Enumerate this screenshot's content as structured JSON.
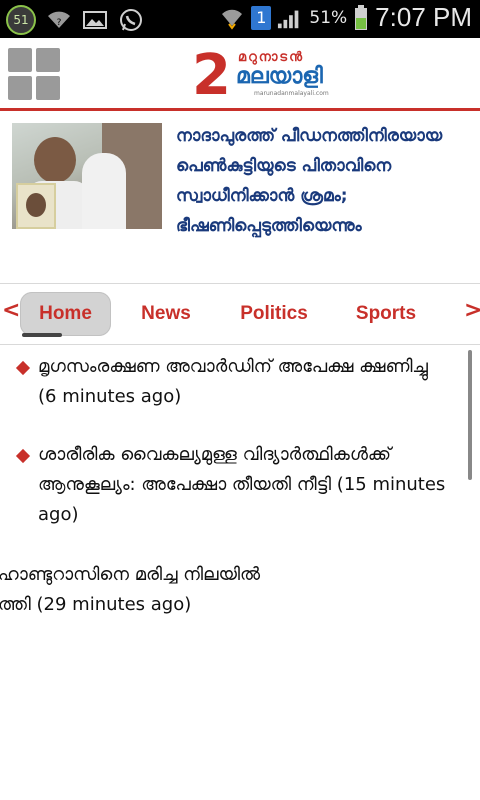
{
  "status_bar": {
    "notification_count": "51",
    "sim_badge": "1",
    "battery": "51%",
    "time": "7:07 PM",
    "icons": [
      "notification-count-icon",
      "wifi-icon",
      "image-icon",
      "whatsapp-icon",
      "wifi-data-icon",
      "signal-icon",
      "battery-icon"
    ]
  },
  "header": {
    "logo_text_top": "മറുനാടൻ",
    "logo_text_main": "മലയാളി",
    "logo_url": "marunadanmalayali.com"
  },
  "featured": {
    "headline": "നാദാപുരത്ത് പീഡനത്തിനിരയായ പെൺകുട്ടിയുടെ പിതാവിനെ സ്വാധീനിക്കാൻ ശ്രമം; ഭീഷണിപ്പെടുത്തിയെന്നും"
  },
  "tabs": {
    "prev_arrow": "<",
    "next_arrow": ">",
    "items": [
      "Home",
      "News",
      "Politics",
      "Sports"
    ],
    "active": "Home"
  },
  "news": [
    {
      "text": "മൃഗസംരക്ഷണ അവാർഡിന് അപേക്ഷ ക്ഷണിച്ചു (6 minutes ago)"
    },
    {
      "text": "ശാരീരിക വൈകല്യമുള്ള വിദ്യാർത്ഥികൾക്ക് ആനുകൂല്യം: അപേക്ഷാ തീയതി നീട്ടി (15 minutes ago)"
    },
    {
      "text_line1": "ഹാണ്ടുറാസിനെ മരിച്ച നിലയിൽ",
      "text_line2": "ത്തി (29 minutes ago)"
    }
  ],
  "colors": {
    "accent": "#c8302a",
    "headline_blue": "#1a3a7c",
    "logo_blue": "#1b66b1"
  }
}
